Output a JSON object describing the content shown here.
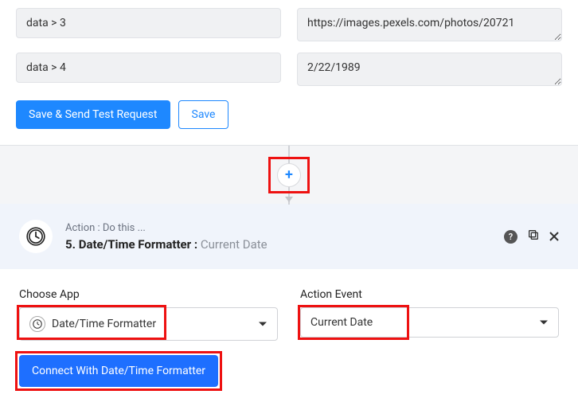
{
  "rows": [
    {
      "left": "data > 3",
      "right": "https://images.pexels.com/photos/20721"
    },
    {
      "left": "data > 4",
      "right": "2/22/1989"
    }
  ],
  "buttons": {
    "save_send": "Save & Send Test Request",
    "save": "Save"
  },
  "plus": "+",
  "step": {
    "action_label": "Action : Do this ...",
    "number": "5.",
    "app": "Date/Time Formatter",
    "sub": "Current Date"
  },
  "choose_app": {
    "label": "Choose App",
    "value": "Date/Time Formatter"
  },
  "action_event": {
    "label": "Action Event",
    "value": "Current Date"
  },
  "connect_label": "Connect With Date/Time Formatter"
}
